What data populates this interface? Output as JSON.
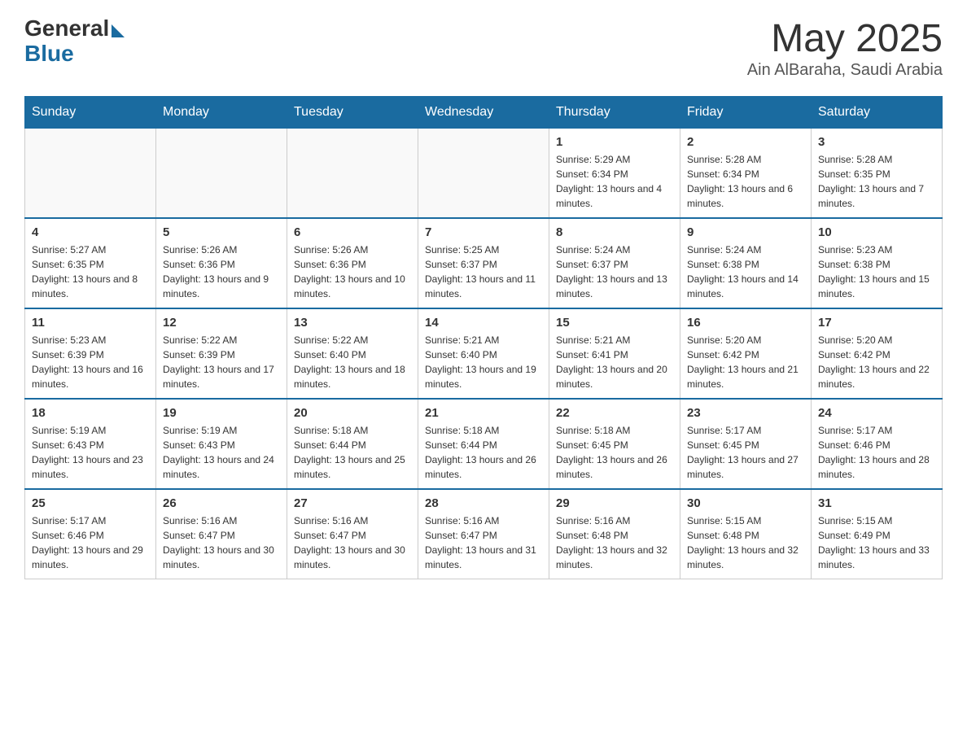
{
  "header": {
    "logo_general": "General",
    "logo_blue": "Blue",
    "month_title": "May 2025",
    "location": "Ain AlBaraha, Saudi Arabia"
  },
  "days_of_week": [
    "Sunday",
    "Monday",
    "Tuesday",
    "Wednesday",
    "Thursday",
    "Friday",
    "Saturday"
  ],
  "weeks": [
    [
      {
        "day": "",
        "info": ""
      },
      {
        "day": "",
        "info": ""
      },
      {
        "day": "",
        "info": ""
      },
      {
        "day": "",
        "info": ""
      },
      {
        "day": "1",
        "info": "Sunrise: 5:29 AM\nSunset: 6:34 PM\nDaylight: 13 hours and 4 minutes."
      },
      {
        "day": "2",
        "info": "Sunrise: 5:28 AM\nSunset: 6:34 PM\nDaylight: 13 hours and 6 minutes."
      },
      {
        "day": "3",
        "info": "Sunrise: 5:28 AM\nSunset: 6:35 PM\nDaylight: 13 hours and 7 minutes."
      }
    ],
    [
      {
        "day": "4",
        "info": "Sunrise: 5:27 AM\nSunset: 6:35 PM\nDaylight: 13 hours and 8 minutes."
      },
      {
        "day": "5",
        "info": "Sunrise: 5:26 AM\nSunset: 6:36 PM\nDaylight: 13 hours and 9 minutes."
      },
      {
        "day": "6",
        "info": "Sunrise: 5:26 AM\nSunset: 6:36 PM\nDaylight: 13 hours and 10 minutes."
      },
      {
        "day": "7",
        "info": "Sunrise: 5:25 AM\nSunset: 6:37 PM\nDaylight: 13 hours and 11 minutes."
      },
      {
        "day": "8",
        "info": "Sunrise: 5:24 AM\nSunset: 6:37 PM\nDaylight: 13 hours and 13 minutes."
      },
      {
        "day": "9",
        "info": "Sunrise: 5:24 AM\nSunset: 6:38 PM\nDaylight: 13 hours and 14 minutes."
      },
      {
        "day": "10",
        "info": "Sunrise: 5:23 AM\nSunset: 6:38 PM\nDaylight: 13 hours and 15 minutes."
      }
    ],
    [
      {
        "day": "11",
        "info": "Sunrise: 5:23 AM\nSunset: 6:39 PM\nDaylight: 13 hours and 16 minutes."
      },
      {
        "day": "12",
        "info": "Sunrise: 5:22 AM\nSunset: 6:39 PM\nDaylight: 13 hours and 17 minutes."
      },
      {
        "day": "13",
        "info": "Sunrise: 5:22 AM\nSunset: 6:40 PM\nDaylight: 13 hours and 18 minutes."
      },
      {
        "day": "14",
        "info": "Sunrise: 5:21 AM\nSunset: 6:40 PM\nDaylight: 13 hours and 19 minutes."
      },
      {
        "day": "15",
        "info": "Sunrise: 5:21 AM\nSunset: 6:41 PM\nDaylight: 13 hours and 20 minutes."
      },
      {
        "day": "16",
        "info": "Sunrise: 5:20 AM\nSunset: 6:42 PM\nDaylight: 13 hours and 21 minutes."
      },
      {
        "day": "17",
        "info": "Sunrise: 5:20 AM\nSunset: 6:42 PM\nDaylight: 13 hours and 22 minutes."
      }
    ],
    [
      {
        "day": "18",
        "info": "Sunrise: 5:19 AM\nSunset: 6:43 PM\nDaylight: 13 hours and 23 minutes."
      },
      {
        "day": "19",
        "info": "Sunrise: 5:19 AM\nSunset: 6:43 PM\nDaylight: 13 hours and 24 minutes."
      },
      {
        "day": "20",
        "info": "Sunrise: 5:18 AM\nSunset: 6:44 PM\nDaylight: 13 hours and 25 minutes."
      },
      {
        "day": "21",
        "info": "Sunrise: 5:18 AM\nSunset: 6:44 PM\nDaylight: 13 hours and 26 minutes."
      },
      {
        "day": "22",
        "info": "Sunrise: 5:18 AM\nSunset: 6:45 PM\nDaylight: 13 hours and 26 minutes."
      },
      {
        "day": "23",
        "info": "Sunrise: 5:17 AM\nSunset: 6:45 PM\nDaylight: 13 hours and 27 minutes."
      },
      {
        "day": "24",
        "info": "Sunrise: 5:17 AM\nSunset: 6:46 PM\nDaylight: 13 hours and 28 minutes."
      }
    ],
    [
      {
        "day": "25",
        "info": "Sunrise: 5:17 AM\nSunset: 6:46 PM\nDaylight: 13 hours and 29 minutes."
      },
      {
        "day": "26",
        "info": "Sunrise: 5:16 AM\nSunset: 6:47 PM\nDaylight: 13 hours and 30 minutes."
      },
      {
        "day": "27",
        "info": "Sunrise: 5:16 AM\nSunset: 6:47 PM\nDaylight: 13 hours and 30 minutes."
      },
      {
        "day": "28",
        "info": "Sunrise: 5:16 AM\nSunset: 6:47 PM\nDaylight: 13 hours and 31 minutes."
      },
      {
        "day": "29",
        "info": "Sunrise: 5:16 AM\nSunset: 6:48 PM\nDaylight: 13 hours and 32 minutes."
      },
      {
        "day": "30",
        "info": "Sunrise: 5:15 AM\nSunset: 6:48 PM\nDaylight: 13 hours and 32 minutes."
      },
      {
        "day": "31",
        "info": "Sunrise: 5:15 AM\nSunset: 6:49 PM\nDaylight: 13 hours and 33 minutes."
      }
    ]
  ]
}
